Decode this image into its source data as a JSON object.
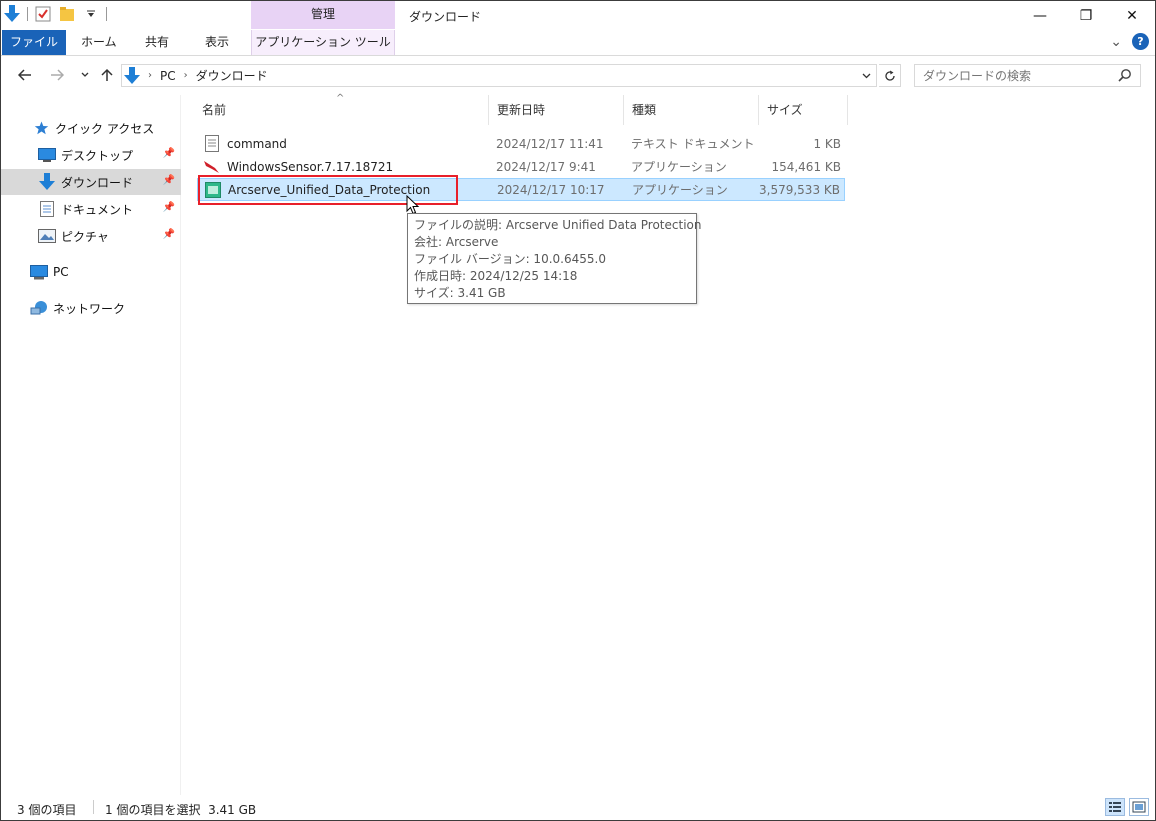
{
  "window": {
    "title": "ダウンロード",
    "context_tab_group": "管理",
    "controls": {
      "minimize": "—",
      "maximize": "❐",
      "close": "✕"
    }
  },
  "ribbon": {
    "tabs": [
      {
        "label": "ファイル",
        "active": true
      },
      {
        "label": "ホーム"
      },
      {
        "label": "共有"
      },
      {
        "label": "表示"
      },
      {
        "label": "アプリケーション ツール"
      }
    ],
    "help": "?",
    "expand": "⌄"
  },
  "address_bar": {
    "crumbs": [
      "PC",
      "ダウンロード"
    ],
    "search_placeholder": "ダウンロードの検索"
  },
  "nav_pane": {
    "items": [
      {
        "label": "クイック アクセス",
        "icon": "star-icon"
      },
      {
        "label": "デスクトップ",
        "icon": "desktop-icon",
        "pinned": true
      },
      {
        "label": "ダウンロード",
        "icon": "download-icon",
        "pinned": true,
        "selected": true
      },
      {
        "label": "ドキュメント",
        "icon": "document-icon",
        "pinned": true
      },
      {
        "label": "ピクチャ",
        "icon": "picture-icon",
        "pinned": true
      },
      {
        "label": "PC",
        "icon": "pc-icon"
      },
      {
        "label": "ネットワーク",
        "icon": "network-icon"
      }
    ]
  },
  "file_list": {
    "columns": [
      "名前",
      "更新日時",
      "種類",
      "サイズ"
    ],
    "sort_indicator": "^",
    "rows": [
      {
        "name": "command",
        "date": "2024/12/17 11:41",
        "type": "テキスト ドキュメント",
        "size": "1 KB",
        "icon": "text-file-icon"
      },
      {
        "name": "WindowsSensor.7.17.18721",
        "date": "2024/12/17 9:41",
        "type": "アプリケーション",
        "size": "154,461 KB",
        "icon": "falcon-app-icon"
      },
      {
        "name": "Arcserve_Unified_Data_Protection",
        "date": "2024/12/17 10:17",
        "type": "アプリケーション",
        "size": "3,579,533 KB",
        "icon": "arcserve-app-icon",
        "selected": true
      }
    ]
  },
  "tooltip": {
    "lines": [
      "ファイルの説明: Arcserve Unified Data Protection",
      "会社: Arcserve",
      "ファイル バージョン: 10.0.6455.0",
      "作成日時: 2024/12/25 14:18",
      "サイズ: 3.41 GB"
    ]
  },
  "status_bar": {
    "item_count": "3 個の項目",
    "selection": "1 個の項目を選択  3.41 GB"
  },
  "colors": {
    "file_tab": "#1a63b8",
    "context_tab": "#e8d3f5",
    "selection": "#cce8ff",
    "highlight": "#e8202a"
  }
}
